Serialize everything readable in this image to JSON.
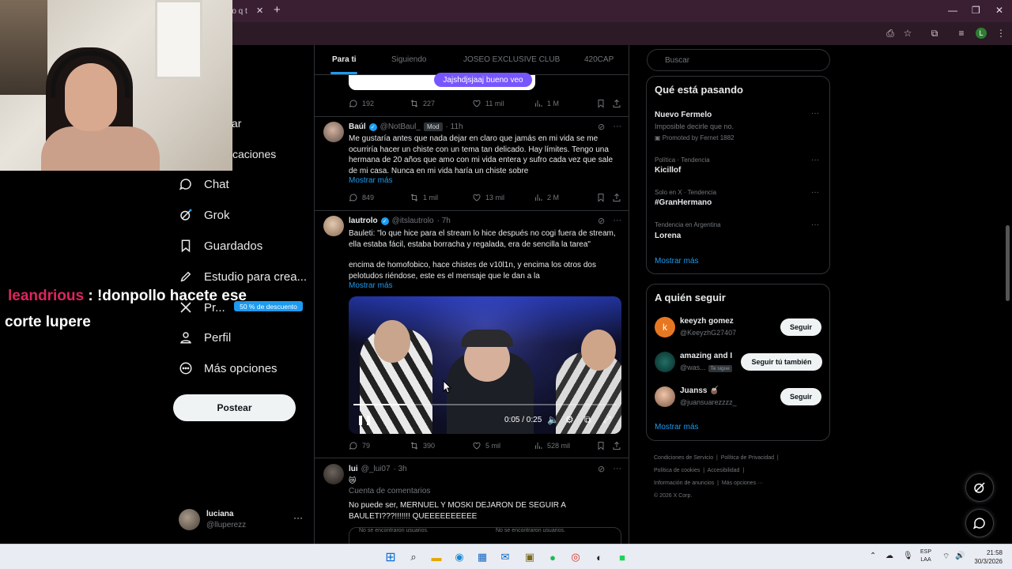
{
  "browser": {
    "tab_title": "ro q t",
    "tab_close": "✕",
    "new_tab": "+"
  },
  "nav": {
    "partial_top": "ar",
    "partial_notif": "caciones",
    "items": [
      {
        "label": "Chat",
        "icon": "chat-icon"
      },
      {
        "label": "Grok",
        "icon": "grok-icon"
      },
      {
        "label": "Guardados",
        "icon": "bookmark-icon"
      },
      {
        "label": "Estudio para crea...",
        "icon": "studio-icon"
      },
      {
        "label": "Pr...",
        "icon": "x-icon"
      },
      {
        "label": "Perfil",
        "icon": "profile-icon"
      },
      {
        "label": "Más opciones",
        "icon": "more-icon"
      }
    ],
    "premium_badge": "50 % de descuento",
    "post_button": "Postear",
    "account": {
      "name": "luciana",
      "handle": "@lluperezz",
      "more": "···"
    }
  },
  "chat_overlay": {
    "user": "leandrious",
    "separator": " : ",
    "message_part1": "!donpollo hacete ese",
    "message_part2": "corte lupere"
  },
  "feed": {
    "tabs": [
      {
        "label": "Para ti",
        "active": true
      },
      {
        "label": "Siguiendo",
        "active": false
      },
      {
        "label": "JOSEO EXCLUSIVE CLUB",
        "active": false
      },
      {
        "label": "420CAP",
        "active": false
      }
    ],
    "poll_choice": "Jajshdjsjaaj bueno veo",
    "top_actions": {
      "replies": "192",
      "reposts": "227",
      "likes": "11 mil",
      "views": "1 M"
    },
    "tweets": [
      {
        "name": "Baúl",
        "handle": "@NotBaul_",
        "badge": "Mod",
        "time": "· 11h",
        "text": "Me gustaría antes que nada dejar en claro que jamás en mi vida se me ocurriría hacer un chiste con un tema tan delicado. Hay límites. Tengo una hermana de 20 años que amo con mi vida entera y sufro cada vez que sale de mi casa. Nunca en mi vida haría un chiste sobre",
        "more": "Mostrar más",
        "actions": {
          "replies": "849",
          "reposts": "1 mil",
          "likes": "13 mil",
          "views": "2 M"
        }
      },
      {
        "name": "lautrolo",
        "handle": "@itslautrolo",
        "time": "· 7h",
        "text1": "Bauleti: \"lo que hice para el stream lo hice después no cogi fuera de stream, ella estaba fácil, estaba borracha y regalada, era de sencilla la tarea\"",
        "text2": "encima de homofobico, hace chistes de v10l1n, y encima los otros dos pelotudos riéndose, este es el mensaje que le dan a la",
        "more": "Mostrar más",
        "video": {
          "time": "0:05 / 0:25",
          "progress": 0.2
        },
        "actions": {
          "replies": "79",
          "reposts": "390",
          "likes": "5 mil",
          "views": "528 mil"
        }
      },
      {
        "name": "lui",
        "handle": "@_lui07",
        "time": "· 3h",
        "emoji": "😿",
        "subtext": "Cuenta de comentarios",
        "text": "No puede ser, MERNUEL Y MOSKI DEJARON DE SEGUIR A BAULETI???!!!!!!! QUEEEEEEEEEE",
        "quote_left": "No se encontraron usuarios.",
        "quote_right": "No se encontraron usuarios."
      }
    ]
  },
  "sidebar": {
    "search_placeholder": "Buscar",
    "trends_title": "Qué está pasando",
    "trends": [
      {
        "context": "",
        "name": "Nuevo Fermelo",
        "sub": "Imposible decirle que no.",
        "promo": "Promoted by Fernet 1882"
      },
      {
        "context": "Política · Tendencia",
        "name": "Kicillof"
      },
      {
        "context": "Solo en X · Tendencia",
        "name": "#GranHermano"
      },
      {
        "context": "Tendencia en Argentina",
        "name": "Lorena"
      }
    ],
    "trends_more": "Mostrar más",
    "follow_title": "A quién seguir",
    "follow": [
      {
        "name": "keeyzh gomez",
        "handle": "@KeeyzhG27407",
        "button": "Seguir",
        "initial": "k"
      },
      {
        "name": "amazing and I",
        "handle": "@was...",
        "badge": "Te sigue",
        "button": "Seguir tú también"
      },
      {
        "name": "Juanss 🧉",
        "handle": "@juansuarezzzz_",
        "button": "Seguir"
      }
    ],
    "follow_more": "Mostrar más",
    "footer": [
      "Condiciones de Servicio",
      "Política de Privacidad",
      "Política de cookies",
      "Accesibilidad",
      "Información de anuncios",
      "Más opciones ···",
      "© 2026 X Corp."
    ]
  },
  "taskbar": {
    "lang1": "ESP",
    "lang2": "LAA",
    "time": "21:58",
    "date": "30/3/2026"
  },
  "colors": {
    "accent": "#1d9bf0",
    "chat_user": "#e0245e",
    "poll": "#7856ff"
  }
}
